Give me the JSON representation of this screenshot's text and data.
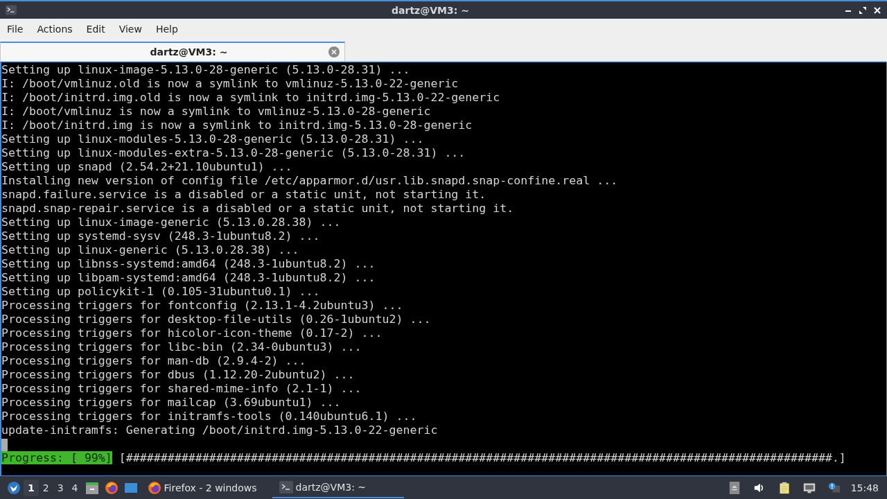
{
  "window": {
    "title": "dartz@VM3: ~"
  },
  "menu": [
    "File",
    "Actions",
    "Edit",
    "View",
    "Help"
  ],
  "tabs": [
    {
      "label": "dartz@VM3: ~",
      "selected": true
    }
  ],
  "terminal": {
    "lines": [
      "Setting up linux-image-5.13.0-28-generic (5.13.0-28.31) ...",
      "I: /boot/vmlinuz.old is now a symlink to vmlinuz-5.13.0-22-generic",
      "I: /boot/initrd.img.old is now a symlink to initrd.img-5.13.0-22-generic",
      "I: /boot/vmlinuz is now a symlink to vmlinuz-5.13.0-28-generic",
      "I: /boot/initrd.img is now a symlink to initrd.img-5.13.0-28-generic",
      "Setting up linux-modules-5.13.0-28-generic (5.13.0-28.31) ...",
      "Setting up linux-modules-extra-5.13.0-28-generic (5.13.0-28.31) ...",
      "Setting up snapd (2.54.2+21.10ubuntu1) ...",
      "Installing new version of config file /etc/apparmor.d/usr.lib.snapd.snap-confine.real ...",
      "snapd.failure.service is a disabled or a static unit, not starting it.",
      "snapd.snap-repair.service is a disabled or a static unit, not starting it.",
      "Setting up linux-image-generic (5.13.0.28.38) ...",
      "Setting up systemd-sysv (248.3-1ubuntu8.2) ...",
      "Setting up linux-generic (5.13.0.28.38) ...",
      "Setting up libnss-systemd:amd64 (248.3-1ubuntu8.2) ...",
      "Setting up libpam-systemd:amd64 (248.3-1ubuntu8.2) ...",
      "Setting up policykit-1 (0.105-31ubuntu0.1) ...",
      "Processing triggers for fontconfig (2.13.1-4.2ubuntu3) ...",
      "Processing triggers for desktop-file-utils (0.26-1ubuntu2) ...",
      "Processing triggers for hicolor-icon-theme (0.17-2) ...",
      "Processing triggers for libc-bin (2.34-0ubuntu3) ...",
      "Processing triggers for man-db (2.9.4-2) ...",
      "Processing triggers for dbus (1.12.20-2ubuntu2) ...",
      "Processing triggers for shared-mime-info (2.1-1) ...",
      "Processing triggers for mailcap (3.69ubuntu1) ...",
      "Processing triggers for initramfs-tools (0.140ubuntu6.1) ...",
      "update-initramfs: Generating /boot/initrd.img-5.13.0-22-generic"
    ],
    "progress": {
      "label": "Progress: [ 99%]",
      "bar": "[######################################################################################################.]"
    }
  },
  "taskbar": {
    "workspaces": [
      {
        "label": "1",
        "selected": true
      },
      {
        "label": "2",
        "selected": false
      },
      {
        "label": "3",
        "selected": false
      },
      {
        "label": "4",
        "selected": false
      }
    ],
    "tasks": [
      {
        "label": "Firefox - 2 windows",
        "kind": "browser",
        "selected": false
      },
      {
        "label": "dartz@VM3: ~",
        "kind": "terminal",
        "selected": true
      }
    ],
    "clock": "15:48"
  }
}
